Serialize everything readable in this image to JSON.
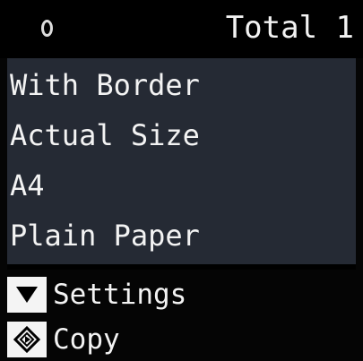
{
  "status": {
    "icon": "wireless-status-icon",
    "total": "Total 1"
  },
  "settings": [
    {
      "label": "With Border"
    },
    {
      "label": "Actual Size"
    },
    {
      "label": "A4"
    },
    {
      "label": "Plain Paper"
    }
  ],
  "actions": {
    "settings": {
      "icon": "down-triangle-icon",
      "label": "Settings"
    },
    "copy": {
      "icon": "start-diamond-icon",
      "label": "Copy"
    }
  }
}
